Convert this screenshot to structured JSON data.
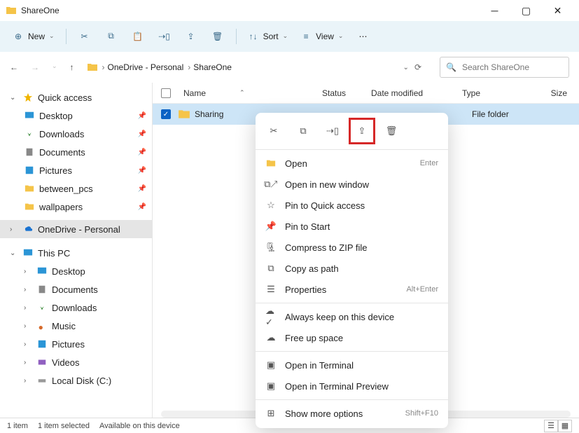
{
  "window": {
    "title": "ShareOne"
  },
  "toolbar": {
    "new": "New",
    "sort": "Sort",
    "view": "View"
  },
  "nav": {
    "crumb1": "OneDrive - Personal",
    "crumb2": "ShareOne"
  },
  "search": {
    "placeholder": "Search ShareOne"
  },
  "sidebar": {
    "quick_access": "Quick access",
    "desktop": "Desktop",
    "downloads": "Downloads",
    "documents": "Documents",
    "pictures": "Pictures",
    "between_pcs": "between_pcs",
    "wallpapers": "wallpapers",
    "onedrive": "OneDrive - Personal",
    "this_pc": "This PC",
    "desktop2": "Desktop",
    "documents2": "Documents",
    "downloads2": "Downloads",
    "music": "Music",
    "pictures2": "Pictures",
    "videos": "Videos",
    "localdisk": "Local Disk (C:)"
  },
  "columns": {
    "name": "Name",
    "status": "Status",
    "date": "Date modified",
    "type": "Type",
    "size": "Size"
  },
  "rows": [
    {
      "name": "Sharing",
      "type": "File folder"
    }
  ],
  "context_menu": {
    "open": "Open",
    "open_shortcut": "Enter",
    "open_new": "Open in new window",
    "pin_qa": "Pin to Quick access",
    "pin_start": "Pin to Start",
    "compress": "Compress to ZIP file",
    "copy_path": "Copy as path",
    "properties": "Properties",
    "properties_shortcut": "Alt+Enter",
    "always_keep": "Always keep on this device",
    "free_up": "Free up space",
    "terminal": "Open in Terminal",
    "terminal_preview": "Open in Terminal Preview",
    "show_more": "Show more options",
    "show_more_shortcut": "Shift+F10"
  },
  "status": {
    "items": "1 item",
    "selected": "1 item selected",
    "availability": "Available on this device"
  }
}
